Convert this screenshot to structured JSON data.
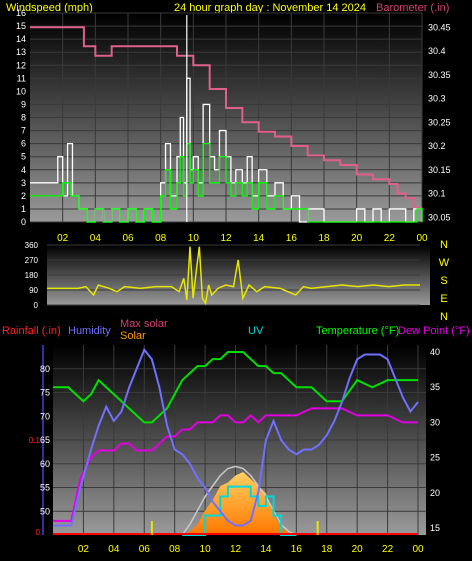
{
  "header": {
    "left": "Windspeed (mph)",
    "center": "24 hour graph day : November 14 2024",
    "right": "Barometer (.in)"
  },
  "wind_dir_labels": [
    "N",
    "W",
    "S",
    "E",
    "N"
  ],
  "bottom_headers": {
    "rainfall": "Rainfall (.in)",
    "humidity": "Humidity",
    "max_solar": "Max solar",
    "solar": "Solar",
    "uv": "UV",
    "temperature": "Temperature (°F)",
    "dew_point": "Dew Point (°F)"
  },
  "colors": {
    "wind_avg": "#00ff00",
    "wind_gust": "#ffffff",
    "barometer": "#e0608c",
    "direction": "#e6e600",
    "humidity": "#7070ff",
    "temperature": "#00e000",
    "dew_point": "#e000e0",
    "solar": "#ff9900",
    "max_solar": "#c8c8c8",
    "uv": "#00d8d8",
    "rain": "#ff0000",
    "header_yellow": "#ffff00",
    "header_barometer": "#d04070"
  },
  "chart_data": [
    {
      "type": "line",
      "name": "wind-barometer",
      "x_ticks": [
        "02",
        "04",
        "06",
        "08",
        "10",
        "12",
        "14",
        "16",
        "18",
        "20",
        "22",
        "00"
      ],
      "ylim": [
        0,
        16
      ],
      "y_ticks": [
        0,
        1,
        2,
        3,
        4,
        5,
        6,
        7,
        8,
        9,
        10,
        11,
        12,
        13,
        14,
        15,
        16
      ],
      "y2lim": [
        30.04,
        30.48
      ],
      "y2_ticks": [
        "30.05",
        "30.1",
        "30.15",
        "30.2",
        "30.25",
        "30.3",
        "30.35",
        "30.4",
        "30.45"
      ],
      "y2_tick_values": [
        30.05,
        30.1,
        30.15,
        30.2,
        30.25,
        30.3,
        30.35,
        30.4,
        30.45
      ],
      "series": [
        {
          "key": "barometer",
          "axis": "right",
          "x": [
            0,
            3,
            3.3,
            4,
            5,
            6,
            7,
            8,
            8.5,
            9,
            10,
            11,
            12,
            13,
            14,
            15,
            16,
            17,
            18,
            19,
            20,
            21,
            22,
            22.5,
            23,
            23.5,
            24
          ],
          "y": [
            30.45,
            30.45,
            30.41,
            30.39,
            30.41,
            30.41,
            30.41,
            30.41,
            30.41,
            30.39,
            30.37,
            30.32,
            30.28,
            30.25,
            30.23,
            30.22,
            30.2,
            30.18,
            30.17,
            30.16,
            30.14,
            30.13,
            30.12,
            30.1,
            30.09,
            30.07,
            30.07
          ]
        },
        {
          "key": "gust",
          "axis": "left",
          "x": [
            0,
            1.5,
            1.7,
            2,
            2.3,
            2.6,
            3,
            3.5,
            4,
            4.5,
            5,
            5.5,
            6,
            6.5,
            7,
            7.5,
            8,
            8.3,
            8.6,
            9,
            9.2,
            9.4,
            9.6,
            9.8,
            10,
            10.3,
            10.6,
            11,
            11.3,
            11.6,
            12,
            12.3,
            12.6,
            13,
            13.3,
            13.6,
            14,
            14.5,
            15,
            15.5,
            16,
            16.5,
            17,
            18,
            19,
            20,
            20.5,
            21,
            21.5,
            22,
            23,
            23.5,
            24
          ],
          "y": [
            3,
            3,
            5,
            2,
            6,
            2,
            1,
            0,
            1,
            0,
            1,
            0,
            1,
            0,
            1,
            0,
            3,
            6,
            2,
            5,
            8,
            3,
            11,
            4,
            5,
            3,
            9,
            5,
            4,
            7,
            5,
            3,
            4,
            3,
            5,
            2,
            4,
            2,
            3,
            1,
            2,
            0,
            1,
            0,
            0,
            1,
            0,
            1,
            0,
            1,
            0,
            1,
            0
          ]
        },
        {
          "key": "avg",
          "axis": "left",
          "x": [
            0,
            1.5,
            2,
            2.5,
            3,
            3.5,
            4,
            4.5,
            5,
            5.5,
            6,
            6.5,
            7,
            7.5,
            8,
            8.3,
            8.6,
            9,
            9.2,
            9.4,
            9.6,
            9.8,
            10,
            10.3,
            10.6,
            11,
            11.3,
            11.6,
            12,
            12.3,
            12.6,
            13,
            13.3,
            13.6,
            14,
            14.5,
            15,
            15.5,
            16,
            17,
            18,
            19,
            20,
            21,
            22,
            23,
            23.7,
            24
          ],
          "y": [
            2,
            2,
            3,
            2,
            1,
            0,
            1,
            0,
            1,
            0,
            1,
            0,
            1,
            0,
            2,
            4,
            1,
            3,
            5,
            2,
            6,
            3,
            4,
            2,
            6,
            3,
            3,
            5,
            3,
            2,
            3,
            2,
            3,
            1,
            3,
            1,
            2,
            1,
            1,
            0,
            0,
            0,
            0,
            0,
            0,
            0,
            1,
            0
          ]
        }
      ]
    },
    {
      "type": "line",
      "name": "wind-direction",
      "ylim": [
        0,
        360
      ],
      "y_ticks": [
        0,
        90,
        180,
        270,
        360
      ],
      "series": [
        {
          "key": "direction",
          "x": [
            0,
            2,
            2.5,
            3,
            3.3,
            4,
            4.5,
            5,
            6,
            7,
            8,
            8.5,
            8.8,
            9,
            9.2,
            9.4,
            9.6,
            9.8,
            10,
            10.2,
            10.4,
            10.6,
            11,
            11.5,
            12,
            12.3,
            12.6,
            13,
            13.5,
            14,
            15,
            16,
            16.5,
            17,
            18,
            19,
            20,
            21,
            22,
            23,
            24
          ],
          "y": [
            100,
            100,
            110,
            60,
            120,
            100,
            80,
            110,
            100,
            110,
            110,
            80,
            160,
            30,
            350,
            40,
            200,
            350,
            40,
            10,
            120,
            60,
            100,
            120,
            110,
            270,
            40,
            120,
            80,
            110,
            100,
            60,
            110,
            100,
            110,
            120,
            110,
            120,
            110,
            120,
            120
          ]
        }
      ]
    },
    {
      "type": "line",
      "name": "humidity-temperature-solar",
      "humidity_ylim": [
        45,
        85
      ],
      "humidity_ticks": [
        50,
        55,
        60,
        65,
        70,
        75,
        80
      ],
      "temp_ylim": [
        14,
        41
      ],
      "temp_ticks": [
        15,
        20,
        25,
        30,
        35,
        40
      ],
      "rain_ylim": [
        0,
        0.2
      ],
      "rain_ticks": [
        0.1
      ],
      "series": [
        {
          "key": "humidity",
          "x": [
            0,
            1.2,
            1.8,
            2.5,
            3,
            3.5,
            4,
            4.5,
            5,
            5.5,
            6,
            6.5,
            7,
            7.5,
            8,
            8.5,
            9,
            9.5,
            10,
            10.5,
            11,
            11.5,
            12,
            12.5,
            13,
            13.5,
            14,
            14.5,
            15,
            15.5,
            16,
            16.5,
            17,
            17.5,
            18,
            18.5,
            19,
            19.5,
            20,
            20.5,
            21,
            21.5,
            22,
            22.5,
            23,
            23.5,
            24
          ],
          "y": [
            47,
            47,
            55,
            63,
            68,
            72,
            69,
            71,
            76,
            80,
            84,
            82,
            76,
            68,
            63,
            62,
            60,
            57,
            55,
            52,
            50,
            48,
            47,
            47,
            48,
            54,
            65,
            69,
            65,
            63,
            62,
            63,
            63,
            64,
            66,
            69,
            73,
            78,
            82,
            83,
            83,
            83,
            82,
            78,
            74,
            71,
            73
          ]
        },
        {
          "key": "temperature",
          "x": [
            0,
            1,
            1.5,
            2,
            2.5,
            3,
            3.5,
            4,
            4.5,
            5,
            5.5,
            6,
            6.5,
            7,
            7.5,
            8,
            8.5,
            9,
            9.5,
            10,
            10.5,
            11,
            11.5,
            12,
            12.5,
            13,
            13.5,
            14,
            14.5,
            15,
            15.5,
            16,
            17,
            18,
            19,
            20,
            21,
            22,
            23,
            24
          ],
          "y": [
            35,
            35,
            34,
            33,
            34,
            36,
            35,
            34,
            33,
            32,
            31,
            30,
            30,
            31,
            32,
            34,
            36,
            37,
            38,
            38,
            39,
            39,
            40,
            40,
            40,
            39,
            38,
            38,
            37,
            37,
            36,
            35,
            35,
            33,
            33,
            36,
            35,
            36,
            36,
            36
          ]
        },
        {
          "key": "dew_point",
          "x": [
            0,
            1.2,
            1.8,
            2.5,
            3,
            3.5,
            4,
            4.5,
            5,
            5.5,
            6,
            6.5,
            7,
            7.5,
            8,
            8.5,
            9,
            9.5,
            10,
            10.5,
            11,
            11.5,
            12,
            12.5,
            13,
            13.5,
            14,
            14.5,
            15,
            15.5,
            16,
            17,
            18,
            19,
            20,
            21,
            22,
            23,
            24
          ],
          "y": [
            16,
            16,
            22,
            25,
            26,
            26,
            26,
            27,
            27,
            26,
            26,
            26,
            27,
            28,
            28,
            29,
            29,
            30,
            30,
            30,
            31,
            31,
            30,
            30,
            31,
            30,
            31,
            31,
            31,
            31,
            31,
            32,
            32,
            32,
            31,
            31,
            31,
            30,
            30
          ]
        },
        {
          "key": "max_solar",
          "x": [
            8.5,
            9,
            9.5,
            10,
            10.5,
            11,
            11.5,
            12,
            12.5,
            13,
            13.5,
            14,
            14.5,
            15,
            15.5,
            16
          ],
          "y": [
            0,
            15,
            35,
            55,
            70,
            85,
            95,
            98,
            95,
            85,
            70,
            55,
            35,
            15,
            5,
            0
          ]
        },
        {
          "key": "solar",
          "x": [
            8.5,
            9,
            9.5,
            10,
            10.5,
            11,
            11.5,
            12,
            12.5,
            13,
            13.5,
            14,
            14.5,
            15,
            15.5,
            16
          ],
          "y": [
            0,
            5,
            15,
            35,
            50,
            70,
            75,
            85,
            90,
            80,
            70,
            60,
            30,
            10,
            3,
            0
          ]
        },
        {
          "key": "uv",
          "x": [
            8.5,
            9,
            9.5,
            10,
            10.5,
            11,
            11.5,
            12,
            12.5,
            13,
            13.5,
            14,
            14.5,
            15,
            15.5,
            16
          ],
          "y": [
            0,
            0,
            0,
            2,
            2,
            4,
            5,
            5,
            5,
            4,
            3,
            4,
            2,
            0,
            0,
            0
          ]
        },
        {
          "key": "rain",
          "x": [
            0,
            24
          ],
          "y": [
            0,
            0
          ]
        }
      ]
    }
  ]
}
